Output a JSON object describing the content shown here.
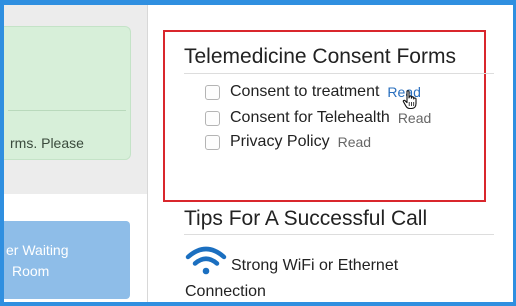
{
  "alert": {
    "text": "rms. Please"
  },
  "waiting_room": {
    "label_line1": "er Waiting",
    "label_line2": "Room"
  },
  "consent": {
    "title": "Telemedicine Consent Forms",
    "items": [
      {
        "label": "Consent to treatment",
        "link": "Read"
      },
      {
        "label": "Consent for Telehealth",
        "link": "Read"
      },
      {
        "label": "Privacy Policy",
        "link": "Read"
      }
    ]
  },
  "tips": {
    "title": "Tips For A Successful Call",
    "items": [
      {
        "icon": "wifi-icon",
        "line1": "Strong WiFi or Ethernet",
        "line2": "Connection"
      }
    ]
  },
  "colors": {
    "highlight_border": "#d9262c",
    "link_active": "#2a6fbe",
    "wifi_icon": "#1b6fc0",
    "waiting_button": "#8ebde8",
    "alert_background": "#d7efd9"
  }
}
